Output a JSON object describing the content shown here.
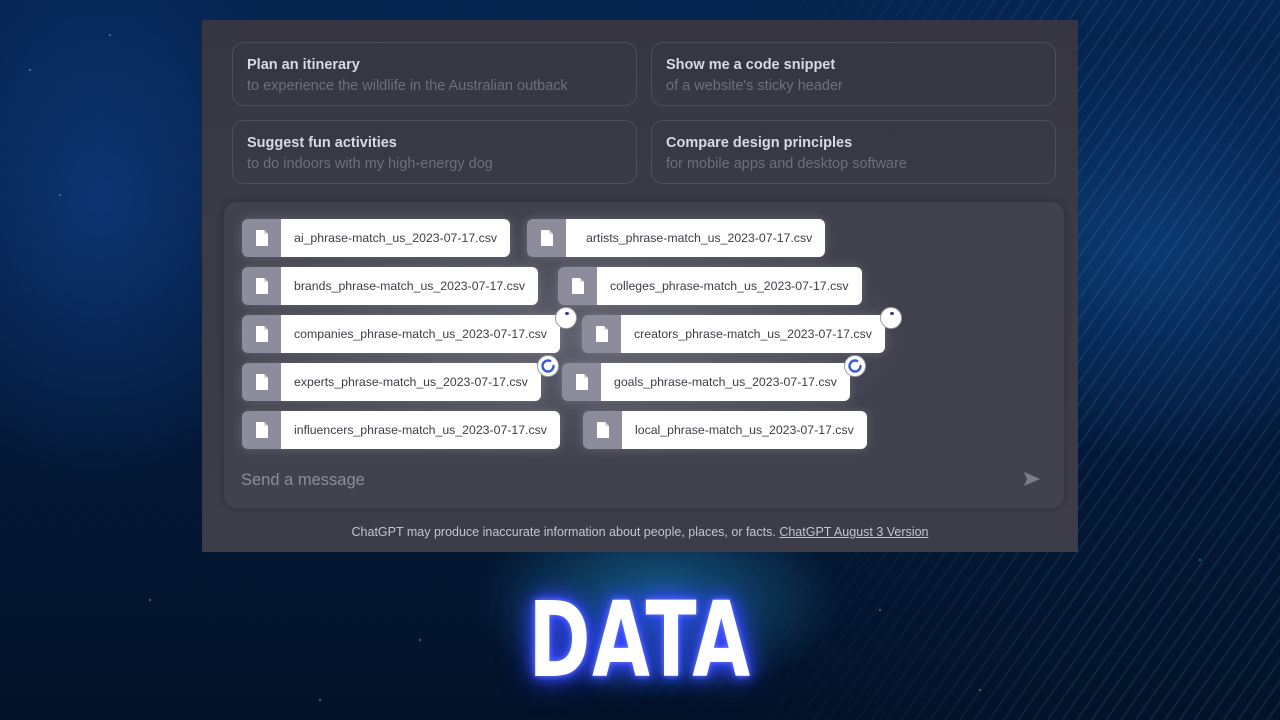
{
  "suggestions": [
    {
      "title": "Plan an itinerary",
      "subtitle": "to experience the wildlife in the Australian outback"
    },
    {
      "title": "Show me a code snippet",
      "subtitle": "of a website's sticky header"
    },
    {
      "title": "Suggest fun activities",
      "subtitle": "to do indoors with my high-energy dog"
    },
    {
      "title": "Compare design principles",
      "subtitle": "for mobile apps and desktop software"
    }
  ],
  "attachments": [
    {
      "name": "ai_phrase-match_us_2023-07-17.csv",
      "icon": "file-icon",
      "status": "none"
    },
    {
      "name": "artists_phrase-match_us_2023-07-17.csv",
      "icon": "file-icon",
      "status": "none"
    },
    {
      "name": "brands_phrase-match_us_2023-07-17.csv",
      "icon": "file-icon",
      "status": "none"
    },
    {
      "name": "colleges_phrase-match_us_2023-07-17.csv",
      "icon": "file-icon",
      "status": "none"
    },
    {
      "name": "companies_phrase-match_us_2023-07-17.csv",
      "icon": "file-icon",
      "status": "pending"
    },
    {
      "name": "creators_phrase-match_us_2023-07-17.csv",
      "icon": "file-icon",
      "status": "pending"
    },
    {
      "name": "experts_phrase-match_us_2023-07-17.csv",
      "icon": "file-icon",
      "status": "uploading"
    },
    {
      "name": "goals_phrase-match_us_2023-07-17.csv",
      "icon": "file-icon",
      "status": "uploading"
    },
    {
      "name": "influencers_phrase-match_us_2023-07-17.csv",
      "icon": "file-icon",
      "status": "none"
    },
    {
      "name": "local_phrase-match_us_2023-07-17.csv",
      "icon": "file-icon",
      "status": "none"
    }
  ],
  "composer": {
    "placeholder": "Send a message",
    "value": "",
    "send_icon": "send-icon"
  },
  "footer": {
    "disclaimer": "ChatGPT may produce inaccurate information about people, places, or facts.",
    "version_link": "ChatGPT August 3 Version"
  },
  "caption": "DATA",
  "colors": {
    "spinner_accent": "#3a5bd9",
    "caption_glow": "#3b4dff"
  }
}
